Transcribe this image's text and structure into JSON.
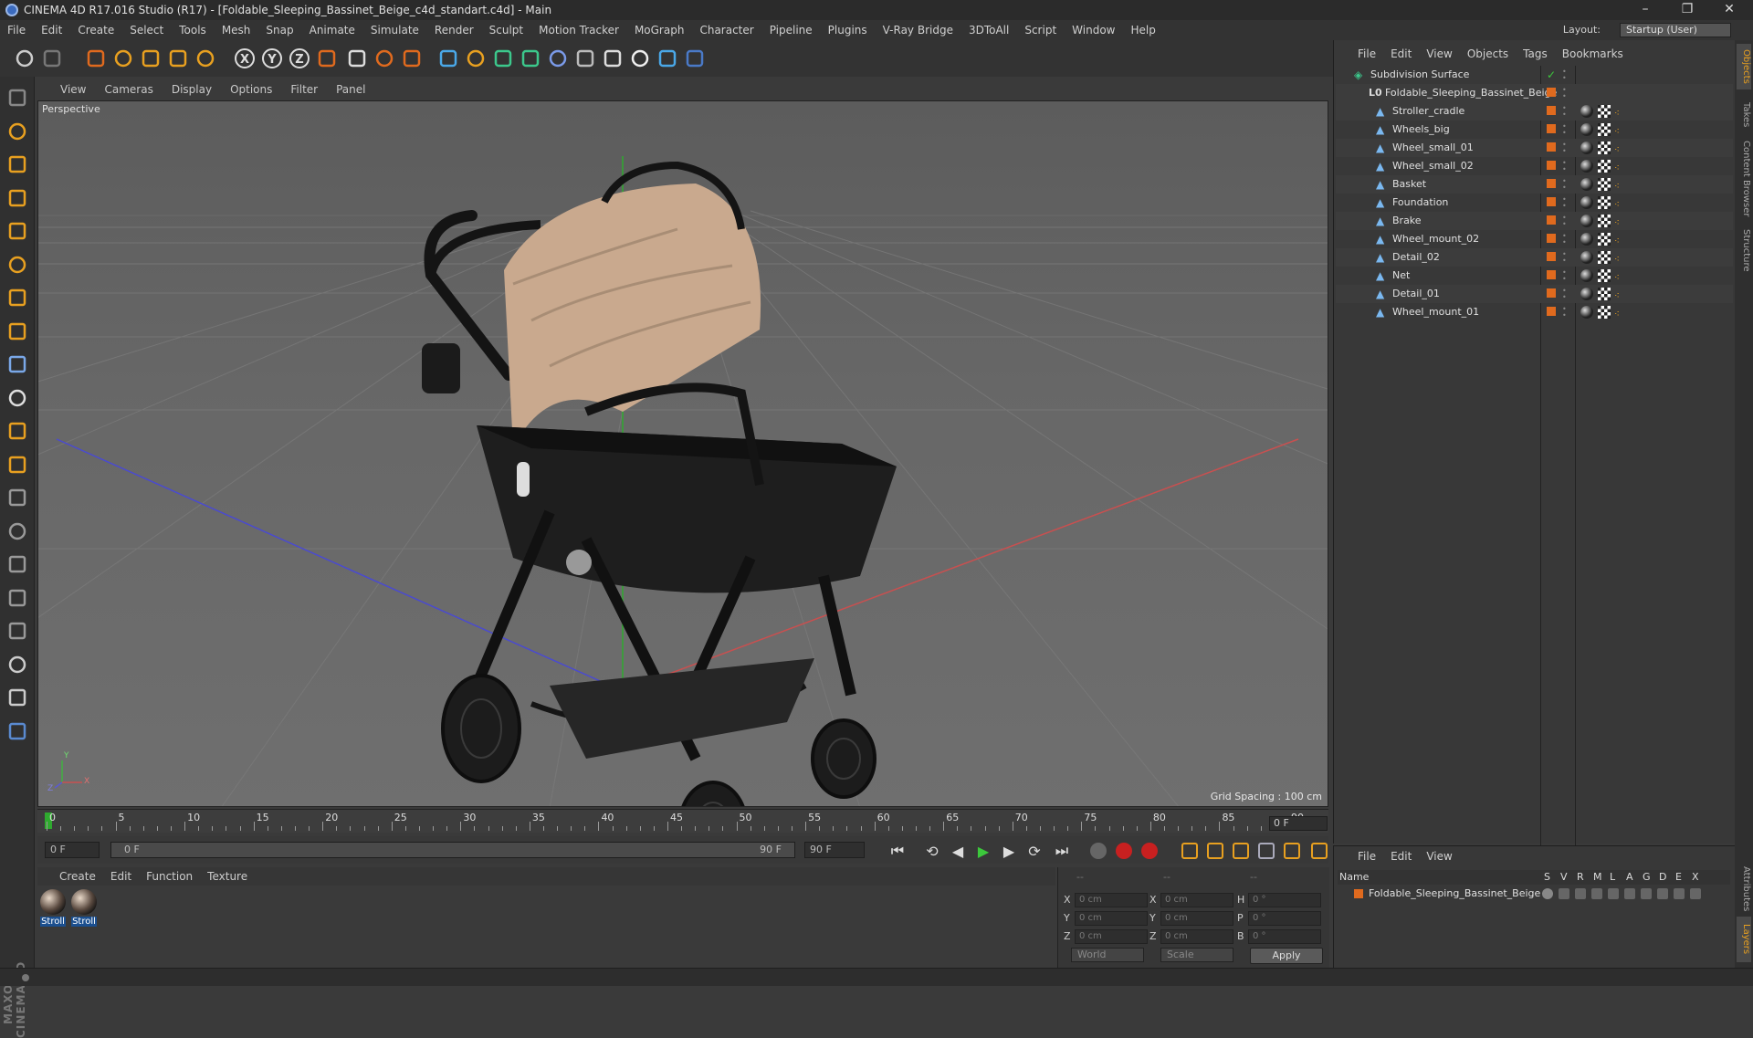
{
  "window": {
    "title": "CINEMA 4D R17.016 Studio (R17) - [Foldable_Sleeping_Bassinet_Beige_c4d_standart.c4d] - Main",
    "controls": [
      "–",
      "❐",
      "✕"
    ]
  },
  "menubar": {
    "items": [
      "File",
      "Edit",
      "Create",
      "Select",
      "Tools",
      "Mesh",
      "Snap",
      "Animate",
      "Simulate",
      "Render",
      "Sculpt",
      "Motion Tracker",
      "MoGraph",
      "Character",
      "Pipeline",
      "Plugins",
      "V-Ray Bridge",
      "3DToAll",
      "Script",
      "Window",
      "Help"
    ],
    "layout_label": "Layout:",
    "layout_value": "Startup (User)"
  },
  "toolbar": {
    "icons": [
      "undo-icon",
      "redo-icon",
      "live-selection-icon",
      "move-icon",
      "scale-icon",
      "rotate-icon",
      "axis-icon",
      "x-axis-icon",
      "y-axis-icon",
      "z-axis-icon",
      "coordinate-system-icon",
      "render-view-icon",
      "render-picture-viewer-icon",
      "render-settings-icon",
      "cube-icon",
      "pen-icon",
      "subdivision-icon",
      "cloner-icon",
      "deformer-icon",
      "floor-icon",
      "camera-icon",
      "light-icon",
      "script-icon",
      "python-icon"
    ],
    "axis_labels": [
      "X",
      "Y",
      "Z"
    ]
  },
  "left_tools": [
    "make-editable-icon",
    "model-mode-icon",
    "texture-mode-icon",
    "workplane-icon",
    "points-mode-icon",
    "edges-mode-icon",
    "polygons-mode-icon",
    "axis-mode-icon",
    "tweak-icon",
    "soft-selection-icon",
    "magnet-icon",
    "knife-icon",
    "brush-icon",
    "bevel-icon",
    "extrude-icon",
    "bridge-icon",
    "loop-icon",
    "grid-snap-icon",
    "locked-workplane-icon",
    "python-icon"
  ],
  "viewport": {
    "menu": [
      "View",
      "Cameras",
      "Display",
      "Options",
      "Filter",
      "Panel"
    ],
    "label": "Perspective",
    "grid_spacing": "Grid Spacing : 100 cm",
    "axis_labels": {
      "y": "Y",
      "x": "X",
      "z": "Z"
    }
  },
  "timeline": {
    "ticks": [
      "0",
      "5",
      "10",
      "15",
      "20",
      "25",
      "30",
      "35",
      "40",
      "45",
      "50",
      "55",
      "60",
      "65",
      "70",
      "75",
      "80",
      "85",
      "90"
    ],
    "current_frame": "0 F"
  },
  "transport": {
    "start_field": "0 F",
    "range_start": "0 F",
    "range_end": "90 F",
    "end_field": "90 F",
    "buttons": [
      "go-to-start-icon",
      "previous-key-icon",
      "play-backwards-icon",
      "play-icon",
      "next-frame-icon",
      "loop-icon",
      "go-to-end-icon"
    ],
    "record_buttons": [
      "record-keys-icon",
      "autokey-icon",
      "keyframe-selection-icon"
    ],
    "key_buttons": [
      "key-position-icon",
      "key-scale-icon",
      "key-rotation-icon",
      "key-param-icon",
      "key-pla-icon",
      "timeline-icon"
    ]
  },
  "materials": {
    "menu": [
      "Create",
      "Edit",
      "Function",
      "Texture"
    ],
    "items": [
      {
        "label": "Stroll"
      },
      {
        "label": "Stroll"
      }
    ]
  },
  "coordinates": {
    "header": [
      "--",
      "--",
      "--"
    ],
    "rows": [
      {
        "a": "X",
        "av": "0 cm",
        "b": "X",
        "bv": "0 cm",
        "c": "H",
        "cv": "0 °"
      },
      {
        "a": "Y",
        "av": "0 cm",
        "b": "Y",
        "bv": "0 cm",
        "c": "P",
        "cv": "0 °"
      },
      {
        "a": "Z",
        "av": "0 cm",
        "b": "Z",
        "bv": "0 cm",
        "c": "B",
        "cv": "0 °"
      }
    ],
    "world": "World",
    "scale": "Scale",
    "apply": "Apply"
  },
  "objects": {
    "menu": [
      "File",
      "Edit",
      "View",
      "Objects",
      "Tags",
      "Bookmarks"
    ],
    "root": "Subdivision Surface",
    "group": "Foldable_Sleeping_Bassinet_Beige",
    "children": [
      "Stroller_cradle",
      "Wheels_big",
      "Wheel_small_01",
      "Wheel_small_02",
      "Basket",
      "Foundation",
      "Brake",
      "Wheel_mount_02",
      "Detail_02",
      "Net",
      "Detail_01",
      "Wheel_mount_01"
    ]
  },
  "layers": {
    "menu": [
      "File",
      "Edit",
      "View"
    ],
    "header_name": "Name",
    "header_cols": [
      "S",
      "V",
      "R",
      "M",
      "L",
      "A",
      "G",
      "D",
      "E",
      "X"
    ],
    "row": "Foldable_Sleeping_Bassinet_Beige"
  },
  "right_tabs": [
    "Objects",
    "Takes",
    "Content Browser",
    "Structure",
    "Attributes",
    "Layers"
  ],
  "colors": {
    "accent_orange": "#e06a1e",
    "selection_blue": "#1b4f8f",
    "green_axis": "#2faa2f"
  }
}
